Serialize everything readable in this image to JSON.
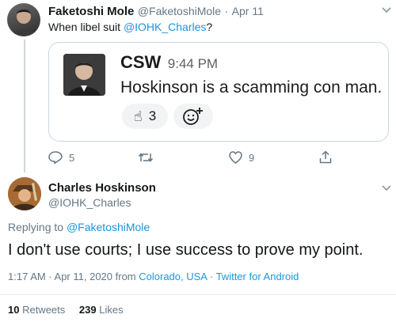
{
  "tweet1": {
    "display_name": "Faketoshi Mole",
    "handle": "@FaketoshiMole",
    "separator": "·",
    "date": "Apr 11",
    "text_prefix": "When libel suit ",
    "mention": "@IOHK_Charles",
    "text_suffix": "?"
  },
  "quote": {
    "author": "CSW",
    "time": "9:44 PM",
    "text": "Hoskinson is a scamming con man.",
    "reaction_count": "3"
  },
  "tweet1_actions": {
    "reply_count": "5",
    "like_count": "9"
  },
  "tweet2": {
    "display_name": "Charles Hoskinson",
    "handle": "@IOHK_Charles",
    "replying_prefix": "Replying to ",
    "replying_to": "@FaketoshiMole",
    "text": "I don't use courts; I use success to prove my point.",
    "meta_time_date": "1:17 AM · Apr 11, 2020 from ",
    "location": "Colorado, USA",
    "meta_sep": " · ",
    "source": "Twitter for Android",
    "retweets_count": "10",
    "retweets_label": " Retweets",
    "likes_count": "239",
    "likes_label": " Likes"
  },
  "colors": {
    "link": "#1b95e0",
    "muted": "#657786",
    "border": "#ccd6dd"
  },
  "icons": [
    "chevron-down-icon",
    "reply-icon",
    "retweet-icon",
    "like-icon",
    "share-icon",
    "add-reaction-icon",
    "pointing-up-emoji-icon"
  ]
}
